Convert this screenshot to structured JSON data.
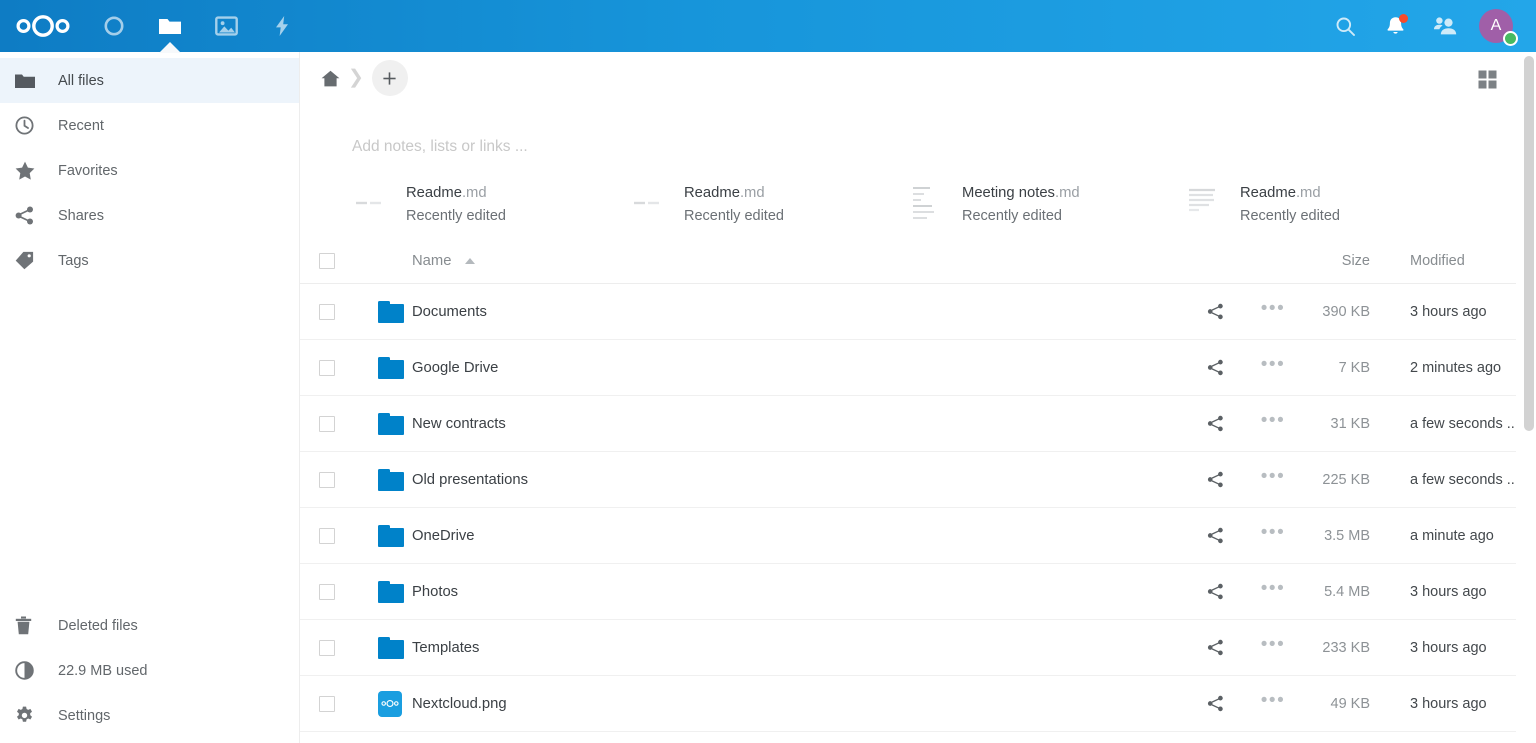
{
  "header": {
    "logo_name": "nextcloud-logo",
    "apps": [
      {
        "name": "dashboard",
        "icon": "circle-icon",
        "active": false
      },
      {
        "name": "files",
        "icon": "folder-icon",
        "active": true
      },
      {
        "name": "photos",
        "icon": "image-icon",
        "active": false
      },
      {
        "name": "activity",
        "icon": "lightning-icon",
        "active": false
      }
    ],
    "search_label": "Search",
    "notifications_label": "Notifications",
    "contacts_label": "Contacts",
    "avatar_initial": "A",
    "avatar_color": "#a05fa8",
    "status_color": "#46ba61",
    "notification_dot_color": "#fa4b2a",
    "accent_color": "#0082c9"
  },
  "sidebar": {
    "top_items": [
      {
        "label": "All files",
        "icon": "folder-icon",
        "selected": true
      },
      {
        "label": "Recent",
        "icon": "clock-icon",
        "selected": false
      },
      {
        "label": "Favorites",
        "icon": "star-icon",
        "selected": false
      },
      {
        "label": "Shares",
        "icon": "share-icon",
        "selected": false
      },
      {
        "label": "Tags",
        "icon": "tag-icon",
        "selected": false
      }
    ],
    "bottom_items": [
      {
        "label": "Deleted files",
        "icon": "trash-icon"
      },
      {
        "label": "22.9 MB used",
        "icon": "quota-icon"
      },
      {
        "label": "Settings",
        "icon": "gear-icon"
      }
    ]
  },
  "controls": {
    "home_label": "Home",
    "new_label": "+",
    "grid_view_label": "Switch to grid view"
  },
  "workspace": {
    "placeholder": "Add notes, lists or links ..."
  },
  "recent": [
    {
      "name": "Readme",
      "ext": ".md",
      "subtitle": "Recently edited",
      "thumb": "text-preview"
    },
    {
      "name": "Readme",
      "ext": ".md",
      "subtitle": "Recently edited",
      "thumb": "text-preview"
    },
    {
      "name": "Meeting notes",
      "ext": ".md",
      "subtitle": "Recently edited",
      "thumb": "text-preview"
    },
    {
      "name": "Readme",
      "ext": ".md",
      "subtitle": "Recently edited",
      "thumb": "text-preview"
    }
  ],
  "table": {
    "columns": {
      "name": "Name",
      "size": "Size",
      "modified": "Modified"
    },
    "sort": {
      "column": "Name",
      "direction": "ascending"
    },
    "rows": [
      {
        "name": "Documents",
        "type": "folder",
        "size": "390 KB",
        "modified": "3 hours ago"
      },
      {
        "name": "Google Drive",
        "type": "folder",
        "size": "7 KB",
        "modified": "2 minutes ago"
      },
      {
        "name": "New contracts",
        "type": "folder",
        "size": "31 KB",
        "modified": "a few seconds ..."
      },
      {
        "name": "Old presentations",
        "type": "folder",
        "size": "225 KB",
        "modified": "a few seconds ..."
      },
      {
        "name": "OneDrive",
        "type": "folder",
        "size": "3.5 MB",
        "modified": "a minute ago"
      },
      {
        "name": "Photos",
        "type": "folder",
        "size": "5.4 MB",
        "modified": "3 hours ago"
      },
      {
        "name": "Templates",
        "type": "folder",
        "size": "233 KB",
        "modified": "3 hours ago"
      },
      {
        "name": "Nextcloud.png",
        "type": "image",
        "size": "49 KB",
        "modified": "3 hours ago"
      }
    ],
    "menu_glyph": "•••"
  }
}
